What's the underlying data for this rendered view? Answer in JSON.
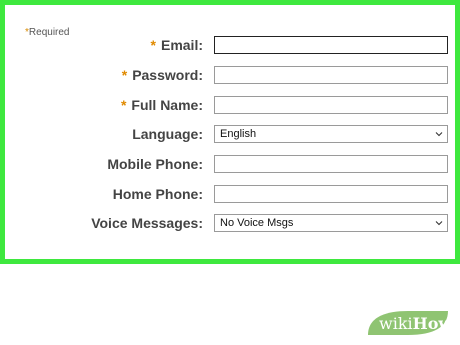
{
  "form": {
    "required_note": "Required",
    "required_mark": "*",
    "fields": [
      {
        "label": "Email:",
        "required": true,
        "type": "text",
        "value": ""
      },
      {
        "label": "Password:",
        "required": true,
        "type": "password",
        "value": ""
      },
      {
        "label": "Full Name:",
        "required": true,
        "type": "text",
        "value": ""
      },
      {
        "label": "Language:",
        "required": false,
        "type": "select",
        "value": "English"
      },
      {
        "label": "Mobile Phone:",
        "required": false,
        "type": "text",
        "value": ""
      },
      {
        "label": "Home Phone:",
        "required": false,
        "type": "text",
        "value": ""
      },
      {
        "label": "Voice Messages:",
        "required": false,
        "type": "select",
        "value": "No Voice Msgs"
      }
    ]
  },
  "colors": {
    "frame_border": "#3ee83e",
    "required_star": "#e08a00",
    "label_text": "#444444",
    "watermark_green": "#8fc472"
  },
  "watermark": {
    "wiki": "wiki",
    "how": "How"
  }
}
